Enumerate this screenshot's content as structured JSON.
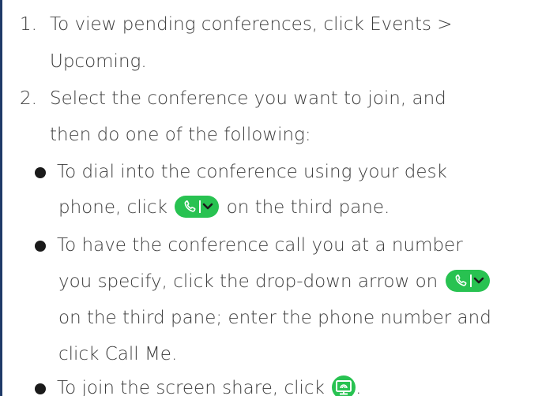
{
  "steps": [
    {
      "number": "1.",
      "lines": [
        "To view pending conferences, click Events >",
        "Upcoming."
      ]
    },
    {
      "number": "2.",
      "lines": [
        "Select the conference you want to join, and",
        "then do one of the following:"
      ]
    }
  ],
  "bullets": {
    "dial": {
      "line1": "To dial into the conference using your desk",
      "line2_before": "phone, click",
      "line2_after": "on the third pane."
    },
    "call_me": {
      "line1": "To have the conference call you at a number",
      "line2_before": "you specify, click the drop-down arrow on",
      "line3": "on the third pane; enter the phone number and",
      "line4": "click Call Me."
    },
    "share": {
      "before": "To join the screen share, click",
      "after": "."
    }
  },
  "icons": {
    "call_button": "phone-dropdown-icon",
    "share_button": "screen-share-icon"
  },
  "colors": {
    "accent_green": "#28c251",
    "left_border": "#1f3a68",
    "text": "#3c3c3c"
  }
}
